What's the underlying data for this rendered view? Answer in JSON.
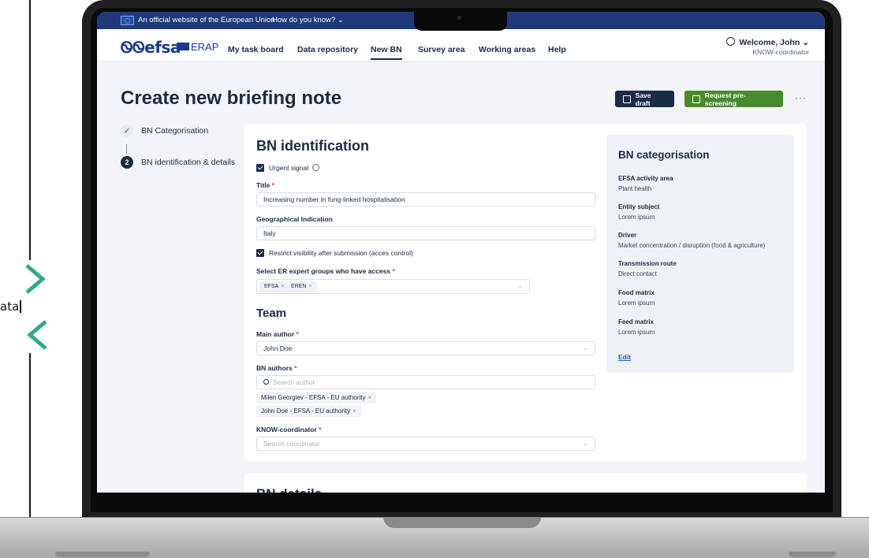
{
  "decoration": {
    "left_text": "ata"
  },
  "eu_bar": {
    "official_text": "An official website of the European Union",
    "how_text": "How do you know?",
    "how_chevron": "chevron-down-icon"
  },
  "nav": {
    "logo": "efsa",
    "logo_sub": "ERAP",
    "items": [
      {
        "label": "My task board"
      },
      {
        "label": "Data repository"
      },
      {
        "label": "New BN",
        "active": true
      },
      {
        "label": "Survey area"
      },
      {
        "label": "Working areas"
      },
      {
        "label": "Help"
      }
    ],
    "user_greeting": "Welcome, John",
    "user_role": "KNOW-coordinator"
  },
  "page": {
    "title": "Create new briefing note",
    "save_draft": "Save draft",
    "request_prescreening": "Request pre-screening",
    "more": "···"
  },
  "stepper": {
    "steps": [
      {
        "marker": "✓",
        "label": "BN Categorisation",
        "state": "done"
      },
      {
        "marker": "2",
        "label": "BN identification & details",
        "state": "current"
      }
    ]
  },
  "form": {
    "section_title": "BN identification",
    "urgent_signal": "Urgent signal",
    "title_label": "Title",
    "title_value": "Increasing number in fung-linked hospitalisation",
    "geo_label": "Geographical Indication",
    "geo_value": "Italy",
    "restrict_label": "Restrict visibility after submission (acces control)",
    "expert_groups_label": "Select ER expert groups who have access",
    "expert_groups": [
      "EFSA",
      "EREN"
    ],
    "team_title": "Team",
    "main_author_label": "Main author",
    "main_author_value": "John Doe",
    "bn_authors_label": "BN authors",
    "search_author_placeholder": "Search author",
    "authors": [
      "Milen Georgiev - EFSA - EU authority",
      "John Doe - EFSA - EU authority"
    ],
    "coordinator_label": "KNOW-coordinator",
    "coordinator_placeholder": "Search coordinator",
    "required_mark": "*",
    "remove_mark": "×",
    "dropdown_chevron": "⌄"
  },
  "categorisation": {
    "title": "BN categorisation",
    "fields": [
      {
        "key": "EFSA activity area",
        "value": "Plant health"
      },
      {
        "key": "Entity subject",
        "value": "Lorem ipsum"
      },
      {
        "key": "Driver",
        "value": "Market concentration / disruption (food & agriculture)"
      },
      {
        "key": "Transmission route",
        "value": "Direct contact"
      },
      {
        "key": "Food matrix",
        "value": "Lorem ipsum"
      },
      {
        "key": "Feed matrix",
        "value": "Lorem ipsum"
      }
    ],
    "edit": "Edit"
  },
  "next_section": {
    "title": "BN details"
  },
  "colors": {
    "navy": "#1b2a45",
    "eu_blue": "#1f3a78",
    "green": "#4a8a2e",
    "teal_chevron": "#2eaa8a",
    "page_bg": "#f2f4f8"
  }
}
